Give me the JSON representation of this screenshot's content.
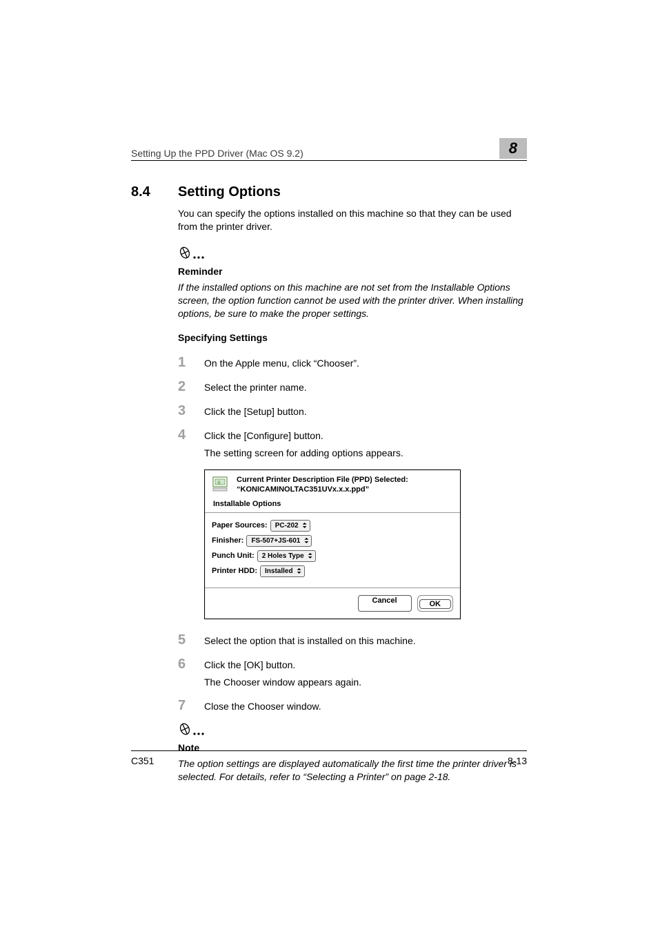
{
  "running_head": {
    "title": "Setting Up the PPD Driver (Mac OS 9.2)",
    "chapter_number": "8"
  },
  "section": {
    "number": "8.4",
    "title": "Setting Options",
    "intro": "You can specify the options installed on this machine so that they can be used from the printer driver."
  },
  "reminder": {
    "title": "Reminder",
    "body": "If the installed options on this machine are not set from the Installable Options screen, the option function cannot be used with the printer driver. When installing options, be sure to make the proper settings."
  },
  "subheading": "Specifying Settings",
  "steps": [
    {
      "num": "1",
      "text": "On the Apple menu, click “Chooser”."
    },
    {
      "num": "2",
      "text": "Select the printer name."
    },
    {
      "num": "3",
      "text": "Click the [Setup] button."
    },
    {
      "num": "4",
      "text": "Click the [Configure] button.",
      "sub": "The setting screen for adding options appears."
    },
    {
      "num": "5",
      "text": "Select the option that is installed on this machine."
    },
    {
      "num": "6",
      "text": "Click the [OK] button.",
      "sub": "The Chooser window appears again."
    },
    {
      "num": "7",
      "text": "Close the Chooser window."
    }
  ],
  "dialog": {
    "header_line1": "Current Printer Description File (PPD) Selected:",
    "header_line2": "“KONICAMINOLTAC351UVx.x.x.ppd”",
    "sub_header": "Installable Options",
    "options": [
      {
        "label": "Paper Sources:",
        "value": "PC-202"
      },
      {
        "label": "Finisher:",
        "value": "FS-507+JS-601"
      },
      {
        "label": "Punch Unit:",
        "value": "2 Holes Type"
      },
      {
        "label": "Printer HDD:",
        "value": "Installed"
      }
    ],
    "cancel": "Cancel",
    "ok": "OK"
  },
  "note": {
    "title": "Note",
    "body": "The option settings are displayed automatically the first time the printer driver is selected. For details, refer to “Selecting a Printer” on page 2-18."
  },
  "footer": {
    "left": "C351",
    "right": "8-13"
  }
}
